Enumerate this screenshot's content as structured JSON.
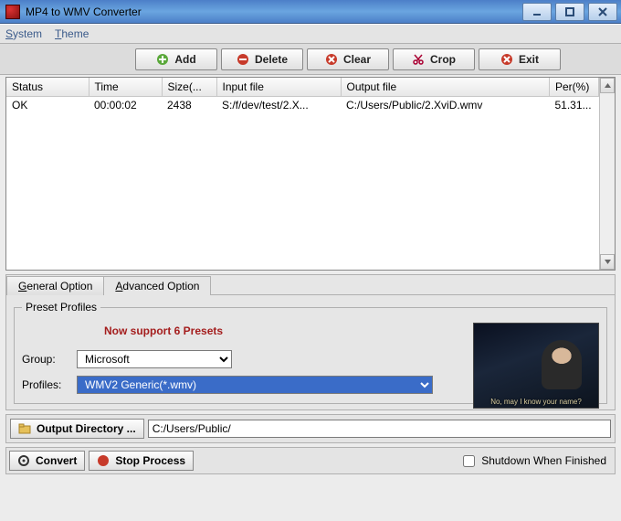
{
  "window": {
    "title": "MP4 to WMV Converter"
  },
  "menu": {
    "system": "System",
    "theme": "Theme"
  },
  "toolbar": {
    "add": "Add",
    "delete": "Delete",
    "clear": "Clear",
    "crop": "Crop",
    "exit": "Exit"
  },
  "table": {
    "headers": {
      "status": "Status",
      "time": "Time",
      "size": "Size(...",
      "input": "Input file",
      "output": "Output file",
      "per": "Per(%)"
    },
    "rows": [
      {
        "status": "OK",
        "time": "00:00:02",
        "size": "2438",
        "input": "S:/f/dev/test/2.X...",
        "output": "C:/Users/Public/2.XviD.wmv",
        "per": "51.31..."
      }
    ]
  },
  "tabs": {
    "general": "General Option",
    "advanced": "Advanced Option"
  },
  "preset": {
    "legend": "Preset Profiles",
    "message": "Now support 6 Presets",
    "group_label": "Group:",
    "group_value": "Microsoft",
    "profiles_label": "Profiles:",
    "profiles_value": "WMV2 Generic(*.wmv)",
    "thumb_sub": "No, may I know your name?"
  },
  "output": {
    "button": "Output Directory ...",
    "path": "C:/Users/Public/"
  },
  "bottom": {
    "convert": "Convert",
    "stop": "Stop Process",
    "shutdown": "Shutdown When Finished"
  }
}
